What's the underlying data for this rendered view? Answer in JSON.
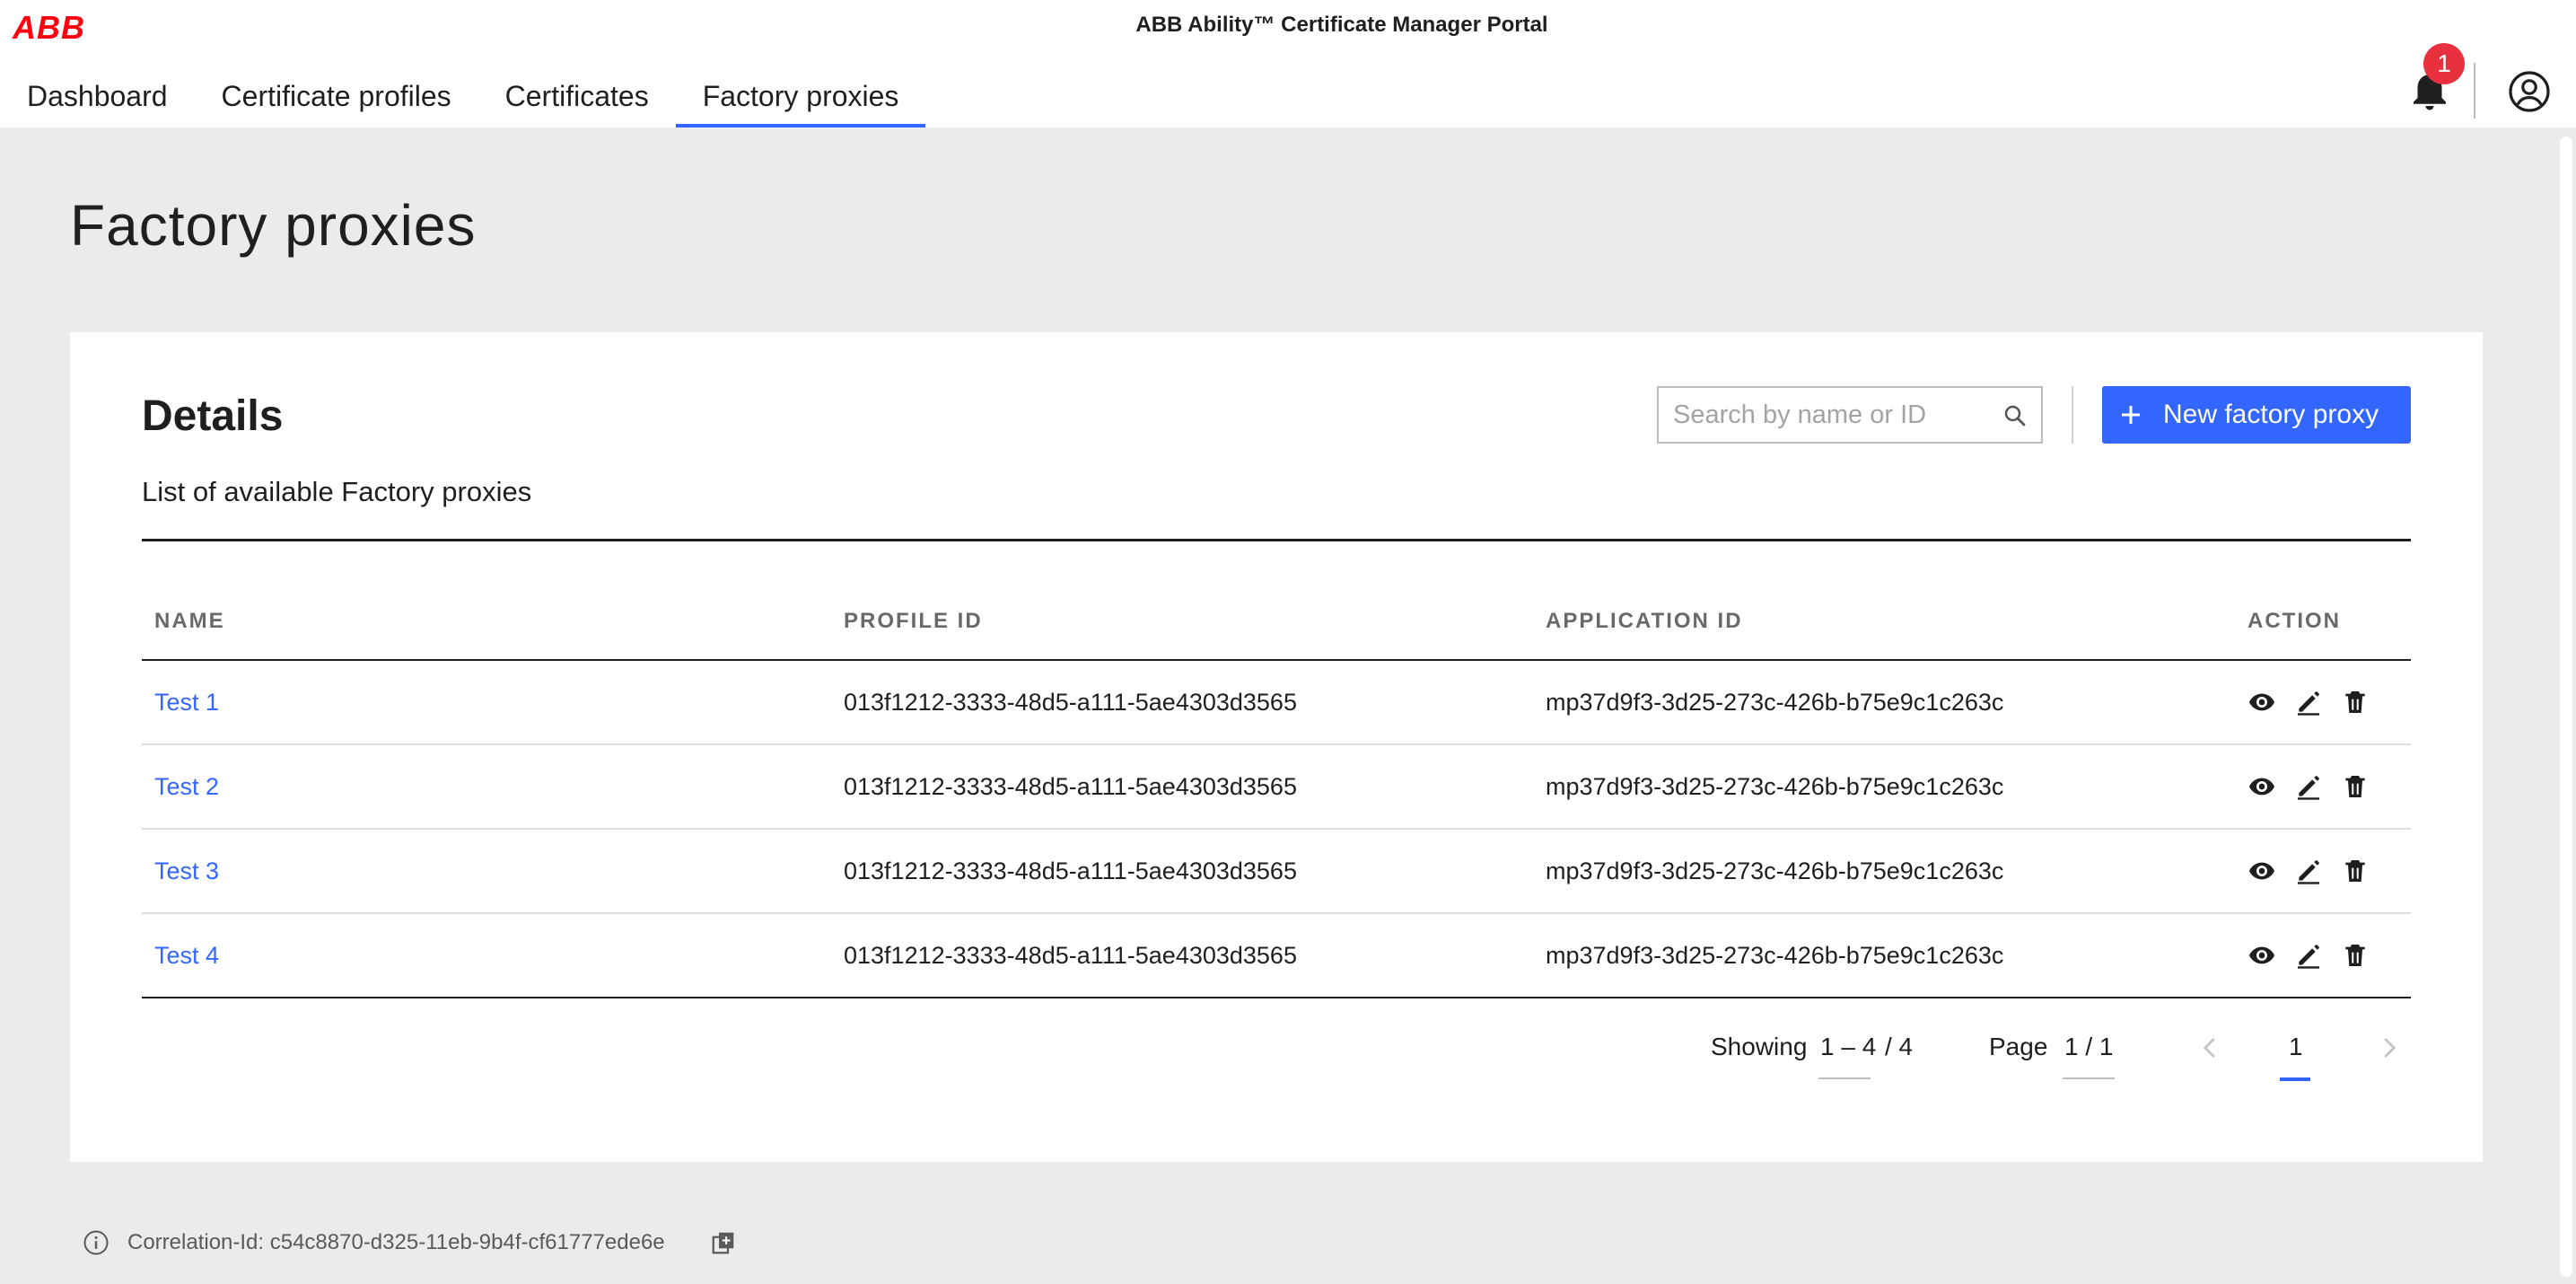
{
  "header": {
    "logo": "ABB",
    "app_title": "ABB Ability™ Certificate Manager Portal",
    "nav": [
      {
        "label": "Dashboard"
      },
      {
        "label": "Certificate profiles"
      },
      {
        "label": "Certificates"
      },
      {
        "label": "Factory proxies"
      }
    ],
    "active_nav": "Factory proxies",
    "notification_count": "1",
    "icons": {
      "notifications": "bell-icon",
      "account": "user-circle-icon"
    }
  },
  "page": {
    "title": "Factory proxies"
  },
  "details": {
    "title": "Details",
    "subtitle": "List of available Factory proxies",
    "search": {
      "placeholder": "Search by name or ID",
      "value": ""
    },
    "new_button_label": "New factory proxy"
  },
  "table": {
    "columns": [
      "NAME",
      "PROFILE ID",
      "APPLICATION ID",
      "ACTION"
    ],
    "rows": [
      {
        "name": "Test 1",
        "profile_id": "013f1212-3333-48d5-a111-5ae4303d3565",
        "application_id": "mp37d9f3-3d25-273c-426b-b75e9c1c263c"
      },
      {
        "name": "Test 2",
        "profile_id": "013f1212-3333-48d5-a111-5ae4303d3565",
        "application_id": "mp37d9f3-3d25-273c-426b-b75e9c1c263c"
      },
      {
        "name": "Test 3",
        "profile_id": "013f1212-3333-48d5-a111-5ae4303d3565",
        "application_id": "mp37d9f3-3d25-273c-426b-b75e9c1c263c"
      },
      {
        "name": "Test 4",
        "profile_id": "013f1212-3333-48d5-a111-5ae4303d3565",
        "application_id": "mp37d9f3-3d25-273c-426b-b75e9c1c263c"
      }
    ],
    "action_icons": [
      "eye-icon",
      "pencil-icon",
      "trash-icon"
    ]
  },
  "pagination": {
    "showing_label": "Showing",
    "range": "1 – 4",
    "total": "/ 4",
    "page_label": "Page",
    "page_value": "1 / 1",
    "current_page": "1"
  },
  "footer": {
    "correlation": "Correlation-Id: c54c8870-d325-11eb-9b4f-cf61777ede6e"
  },
  "colors": {
    "accent": "#3366ff",
    "brand": "#ff000f",
    "badge": "#e8303f",
    "background": "#ebebeb"
  }
}
